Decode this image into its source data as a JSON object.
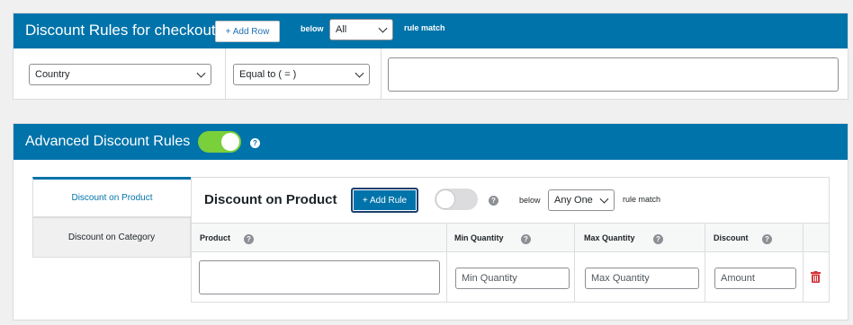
{
  "checkout": {
    "title": "Discount Rules for checkout",
    "add_row_label": "+ Add Row",
    "below_label": "below",
    "match_select_value": "All",
    "rule_match_label": "rule match",
    "condition_field_value": "Country",
    "operator_value": "Equal to ( = )",
    "value_input": ""
  },
  "advanced": {
    "title": "Advanced Discount Rules",
    "toggle_on": true,
    "help_icon": "question-icon",
    "tabs": [
      {
        "label": "Discount on Product",
        "active": true
      },
      {
        "label": "Discount on Category",
        "active": false
      }
    ],
    "panel": {
      "title": "Discount on Product",
      "add_rule_label": "+ Add Rule",
      "toggle_on": false,
      "below_label": "below",
      "match_select_value": "Any One",
      "rule_match_label": "rule match",
      "columns": [
        "Product",
        "Min Quantity",
        "Max Quantity",
        "Discount"
      ],
      "row": {
        "product_value": "",
        "min_qty_placeholder": "Min Quantity",
        "max_qty_placeholder": "Max Quantity",
        "amount_placeholder": "Amount"
      },
      "delete_icon": "trash-icon"
    }
  },
  "colors": {
    "header_blue": "#0073aa",
    "toggle_green": "#7ad03a",
    "delete_red": "#d63638"
  }
}
